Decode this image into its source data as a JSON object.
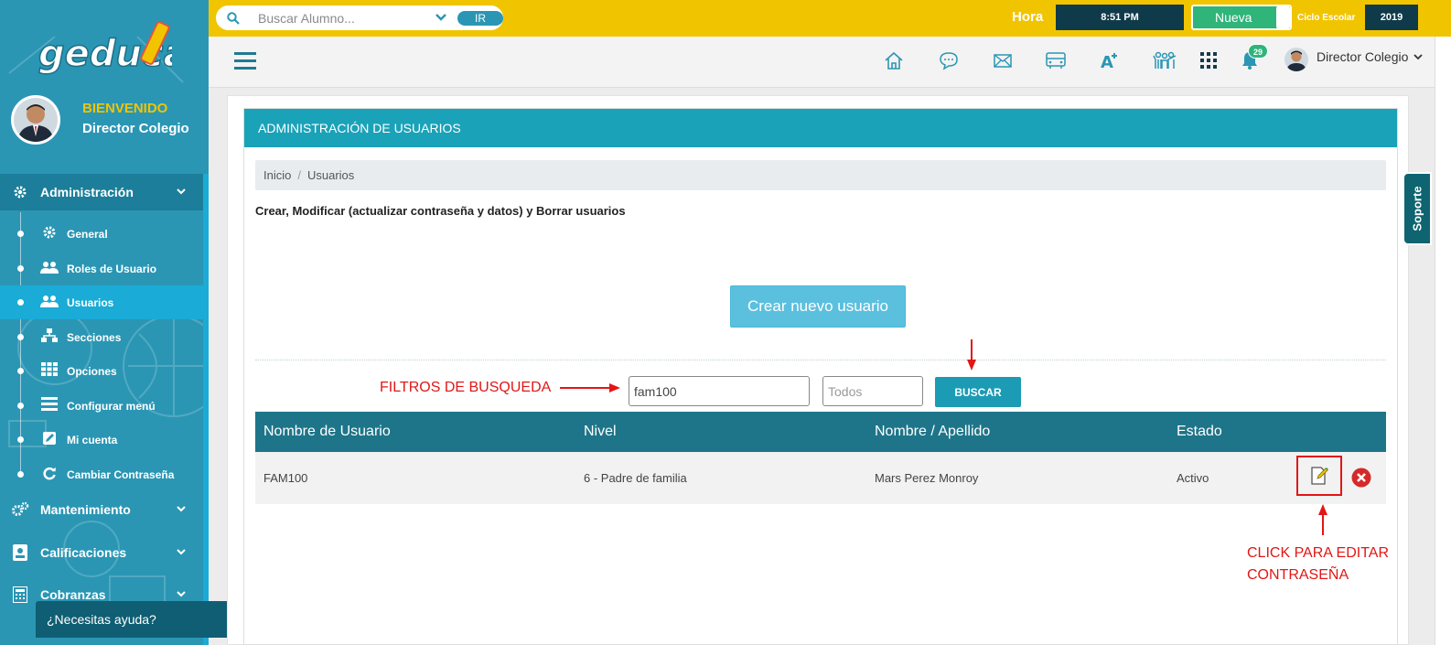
{
  "sidebar": {
    "logo_text": "geducar",
    "welcome": "BIENVENIDO",
    "user_name": "Director Colegio",
    "sections": [
      {
        "label": "Administración",
        "icon": "gear-icon",
        "open": true
      },
      {
        "label": "Mantenimiento",
        "icon": "gears-icon",
        "open": false
      },
      {
        "label": "Calificaciones",
        "icon": "badge-icon",
        "open": false
      },
      {
        "label": "Cobranzas",
        "icon": "calculator-icon",
        "open": false
      }
    ],
    "sub_items": [
      {
        "label": "General",
        "icon": "gear-icon"
      },
      {
        "label": "Roles de Usuario",
        "icon": "users-icon"
      },
      {
        "label": "Usuarios",
        "icon": "users-icon",
        "active": true
      },
      {
        "label": "Secciones",
        "icon": "sitemap-icon"
      },
      {
        "label": "Opciones",
        "icon": "grid-icon"
      },
      {
        "label": "Configurar menú",
        "icon": "list-icon"
      },
      {
        "label": "Mi cuenta",
        "icon": "edit-icon"
      },
      {
        "label": "Cambiar Contraseña",
        "icon": "refresh-icon"
      }
    ],
    "help_text": "¿Necesitas ayuda?"
  },
  "topbar": {
    "search_placeholder": "Buscar Alumno...",
    "go_label": "IR",
    "hora_label": "Hora",
    "hora_value": "8:51 PM",
    "nueva_label": "Nueva",
    "ciclo_label": "Ciclo Escolar",
    "ciclo_value": "2019"
  },
  "navbar": {
    "notification_count": "29",
    "user_label": "Director Colegio"
  },
  "main": {
    "panel_title": "ADMINISTRACIÓN DE USUARIOS",
    "breadcrumb": [
      "Inicio",
      "Usuarios"
    ],
    "description": "Crear, Modificar (actualizar contraseña y datos) y Borrar usuarios",
    "create_button": "Crear nuevo usuario",
    "filters_annotation": "FILTROS DE BUSQUEDA",
    "filter_user_value": "fam100",
    "filter_level_placeholder": "Todos",
    "search_button": "BUSCAR",
    "table": {
      "headers": [
        "Nombre de Usuario",
        "Nivel",
        "Nombre / Apellido",
        "Estado"
      ],
      "rows": [
        [
          "FAM100",
          "6 - Padre de familia",
          "Mars Perez Monroy",
          "Activo"
        ]
      ]
    },
    "edit_annotation_line1": "CLICK PARA EDITAR",
    "edit_annotation_line2": "CONTRASEÑA"
  },
  "support_tab": "Soporte",
  "colors": {
    "sidebar": "#2a96b4",
    "topbar": "#f1c400",
    "panel_header": "#1aa2b8",
    "table_header": "#1e7589",
    "annotation": "#e21616"
  }
}
